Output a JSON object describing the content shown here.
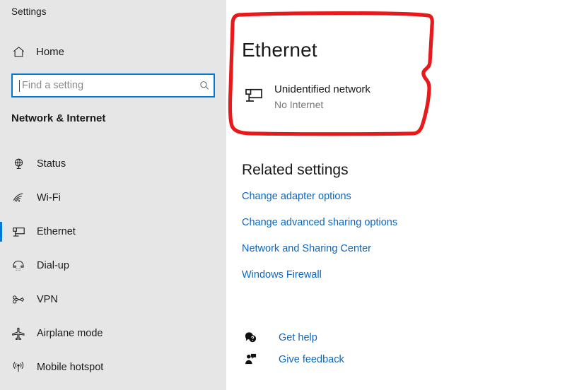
{
  "app": {
    "title": "Settings"
  },
  "sidebar": {
    "home": {
      "label": "Home",
      "icon": "home-icon"
    },
    "search": {
      "value": "",
      "placeholder": "Find a setting",
      "icon": "search-icon"
    },
    "section_title": "Network & Internet",
    "items": [
      {
        "label": "Status",
        "icon": "globe-status-icon",
        "selected": false
      },
      {
        "label": "Wi-Fi",
        "icon": "wifi-icon",
        "selected": false
      },
      {
        "label": "Ethernet",
        "icon": "ethernet-monitor-icon",
        "selected": true
      },
      {
        "label": "Dial-up",
        "icon": "dialup-phone-icon",
        "selected": false
      },
      {
        "label": "VPN",
        "icon": "vpn-key-icon",
        "selected": false
      },
      {
        "label": "Airplane mode",
        "icon": "airplane-icon",
        "selected": false
      },
      {
        "label": "Mobile hotspot",
        "icon": "hotspot-broadcast-icon",
        "selected": false
      }
    ]
  },
  "main": {
    "page_title": "Ethernet",
    "network": {
      "icon": "ethernet-monitor-icon",
      "name": "Unidentified network",
      "status": "No Internet"
    },
    "related": {
      "heading": "Related settings",
      "links": [
        "Change adapter options",
        "Change advanced sharing options",
        "Network and Sharing Center",
        "Windows Firewall"
      ]
    },
    "help": [
      {
        "label": "Get help",
        "icon": "get-help-icon"
      },
      {
        "label": "Give feedback",
        "icon": "give-feedback-icon"
      }
    ]
  },
  "annotation": {
    "type": "hand-drawn-rectangle",
    "color": "#e8191b",
    "stroke_width": 5,
    "encircles": "Ethernet heading and Unidentified network / No Internet status"
  },
  "colors": {
    "sidebar_bg": "#e6e6e6",
    "content_bg": "#ffffff",
    "accent": "#0078d7",
    "link": "#0a66c2",
    "text_primary": "#1a1a1a",
    "text_secondary": "#767676",
    "annotation_red": "#e8191b"
  }
}
